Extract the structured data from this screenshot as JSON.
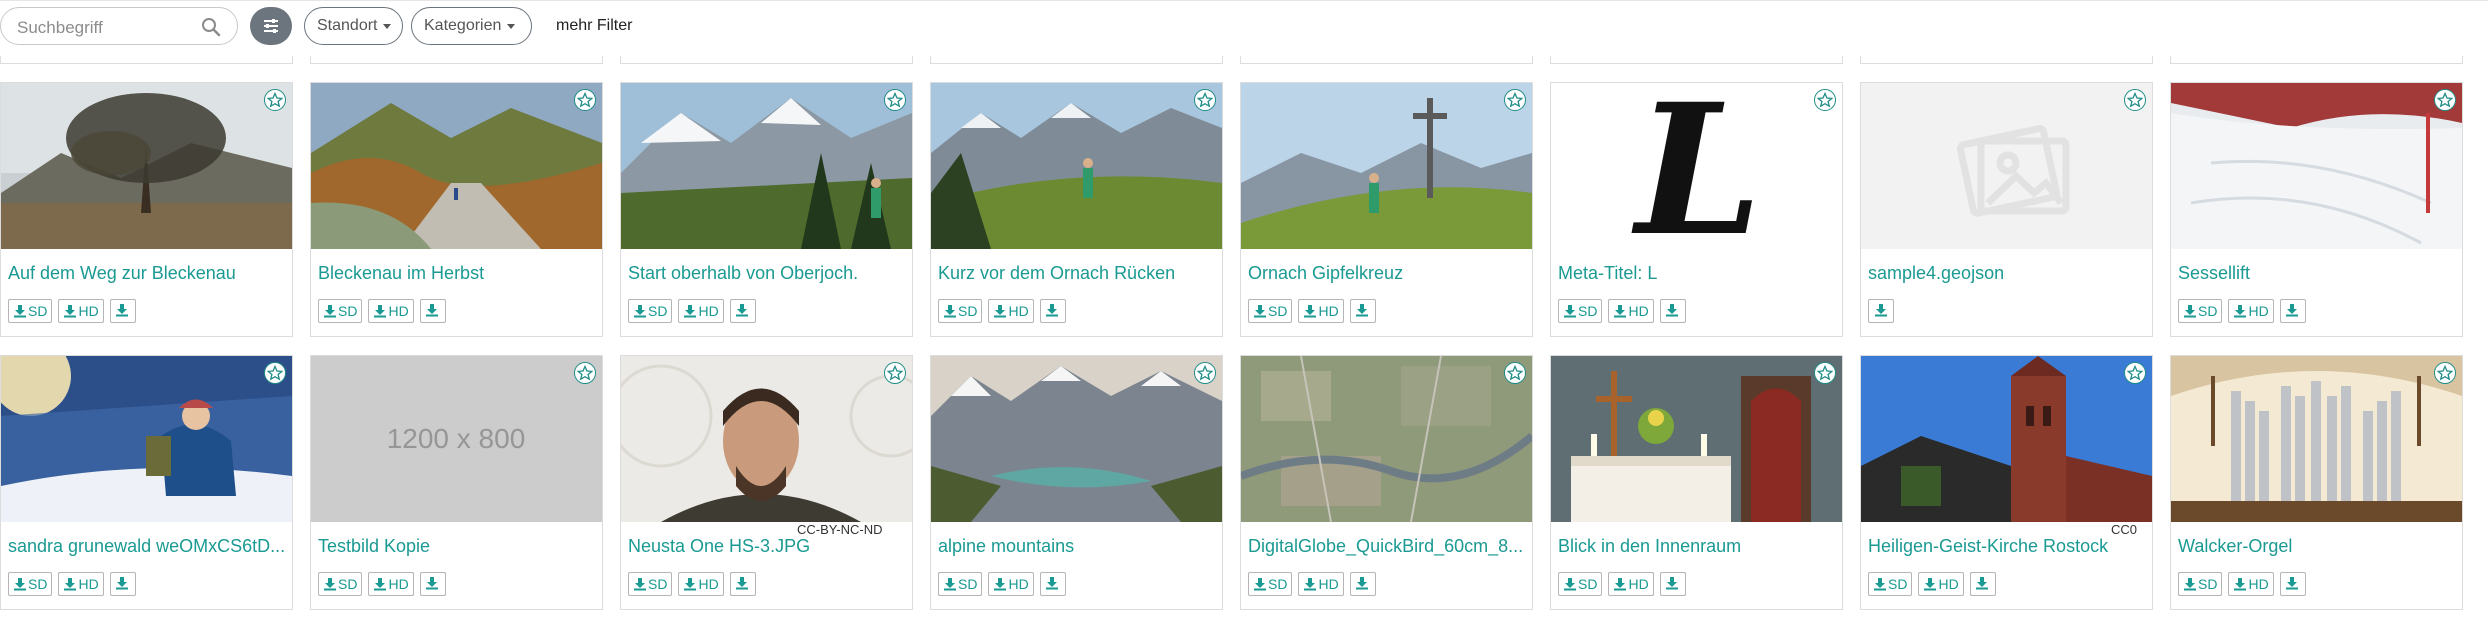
{
  "toolbar": {
    "search_placeholder": "Suchbegriff",
    "filter_icon": "sliders-icon",
    "standort_label": "Standort",
    "kategorien_label": "Kategorien",
    "more_filter_label": "mehr Filter"
  },
  "colors": {
    "accent": "#1a9a92",
    "star": "#1f8c86",
    "filter_button": "#6c757d"
  },
  "cards": [
    {
      "title": "Auf dem Weg zur Bleckenau",
      "thumb": "tree-meadow",
      "downloads": [
        "SD",
        "HD",
        ""
      ]
    },
    {
      "title": "Bleckenau im Herbst",
      "thumb": "autumn-path",
      "downloads": [
        "SD",
        "HD",
        ""
      ]
    },
    {
      "title": "Start oberhalb von Oberjoch.",
      "thumb": "hiker-forest",
      "downloads": [
        "SD",
        "HD",
        ""
      ]
    },
    {
      "title": "Kurz vor dem Ornach Rücken",
      "thumb": "hiker-ridge",
      "downloads": [
        "SD",
        "HD",
        ""
      ]
    },
    {
      "title": "Ornach Gipfelkreuz",
      "thumb": "summit-cross",
      "downloads": [
        "SD",
        "HD",
        ""
      ]
    },
    {
      "title": "Meta-Titel: L",
      "thumb": "letter-l",
      "overlay_letter": "L",
      "downloads": [
        "SD",
        "HD",
        ""
      ]
    },
    {
      "title": "sample4.geojson",
      "thumb": "placeholder-image",
      "downloads": [
        ""
      ]
    },
    {
      "title": "Sessellift",
      "thumb": "ski-slope",
      "downloads": [
        "SD",
        "HD",
        ""
      ]
    },
    {
      "title": "sandra grunewald weOMxCS6tD...",
      "thumb": "snow-hiker",
      "downloads": [
        "SD",
        "HD",
        ""
      ]
    },
    {
      "title": "Testbild Kopie",
      "thumb": "gray-placeholder",
      "overlay_text": "1200 x 800",
      "downloads": [
        "SD",
        "HD",
        ""
      ]
    },
    {
      "title": "Neusta One HS-3.JPG",
      "thumb": "portrait",
      "overlay_text": "CC-BY-NC-ND",
      "downloads": [
        "SD",
        "HD",
        ""
      ]
    },
    {
      "title": "alpine mountains",
      "thumb": "alpine-lake",
      "downloads": [
        "SD",
        "HD",
        ""
      ]
    },
    {
      "title": "DigitalGlobe_QuickBird_60cm_8...",
      "thumb": "satellite",
      "downloads": [
        "SD",
        "HD",
        ""
      ]
    },
    {
      "title": "Blick in den Innenraum",
      "thumb": "church-altar",
      "downloads": [
        "SD",
        "HD",
        ""
      ]
    },
    {
      "title": "Heiligen-Geist-Kirche Rostock",
      "thumb": "church-tower",
      "overlay_text": "CC0",
      "downloads": [
        "SD",
        "HD",
        ""
      ]
    },
    {
      "title": "Walcker-Orgel",
      "thumb": "organ",
      "downloads": [
        "SD",
        "HD",
        ""
      ]
    }
  ]
}
